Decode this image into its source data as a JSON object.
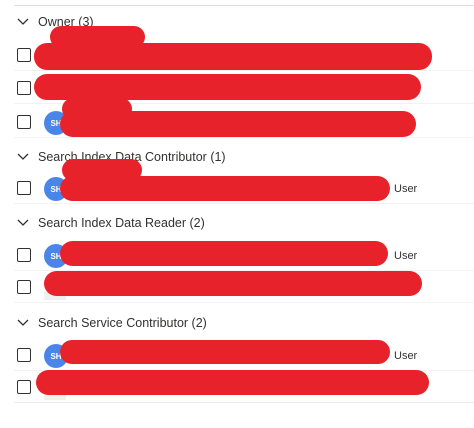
{
  "groups": [
    {
      "label": "Owner (3)",
      "rows": [
        {
          "avatar": "",
          "type": ""
        },
        {
          "avatar": "",
          "type": ""
        },
        {
          "avatar": "SH",
          "type": ""
        }
      ]
    },
    {
      "label": "Search Index Data Contributor (1)",
      "rows": [
        {
          "avatar": "SH",
          "type": "User"
        }
      ]
    },
    {
      "label": "Search Index Data Reader (2)",
      "rows": [
        {
          "avatar": "SH",
          "type": "User"
        },
        {
          "avatar": "",
          "type": ""
        }
      ]
    },
    {
      "label": "Search Service Contributor (2)",
      "rows": [
        {
          "avatar": "SH",
          "type": "User"
        },
        {
          "avatar": "",
          "type": ""
        }
      ]
    }
  ],
  "colors": {
    "redaction": "#e8222a",
    "avatar": "#4a86e8"
  },
  "icons": {
    "collapse": "chevron-down-icon"
  }
}
